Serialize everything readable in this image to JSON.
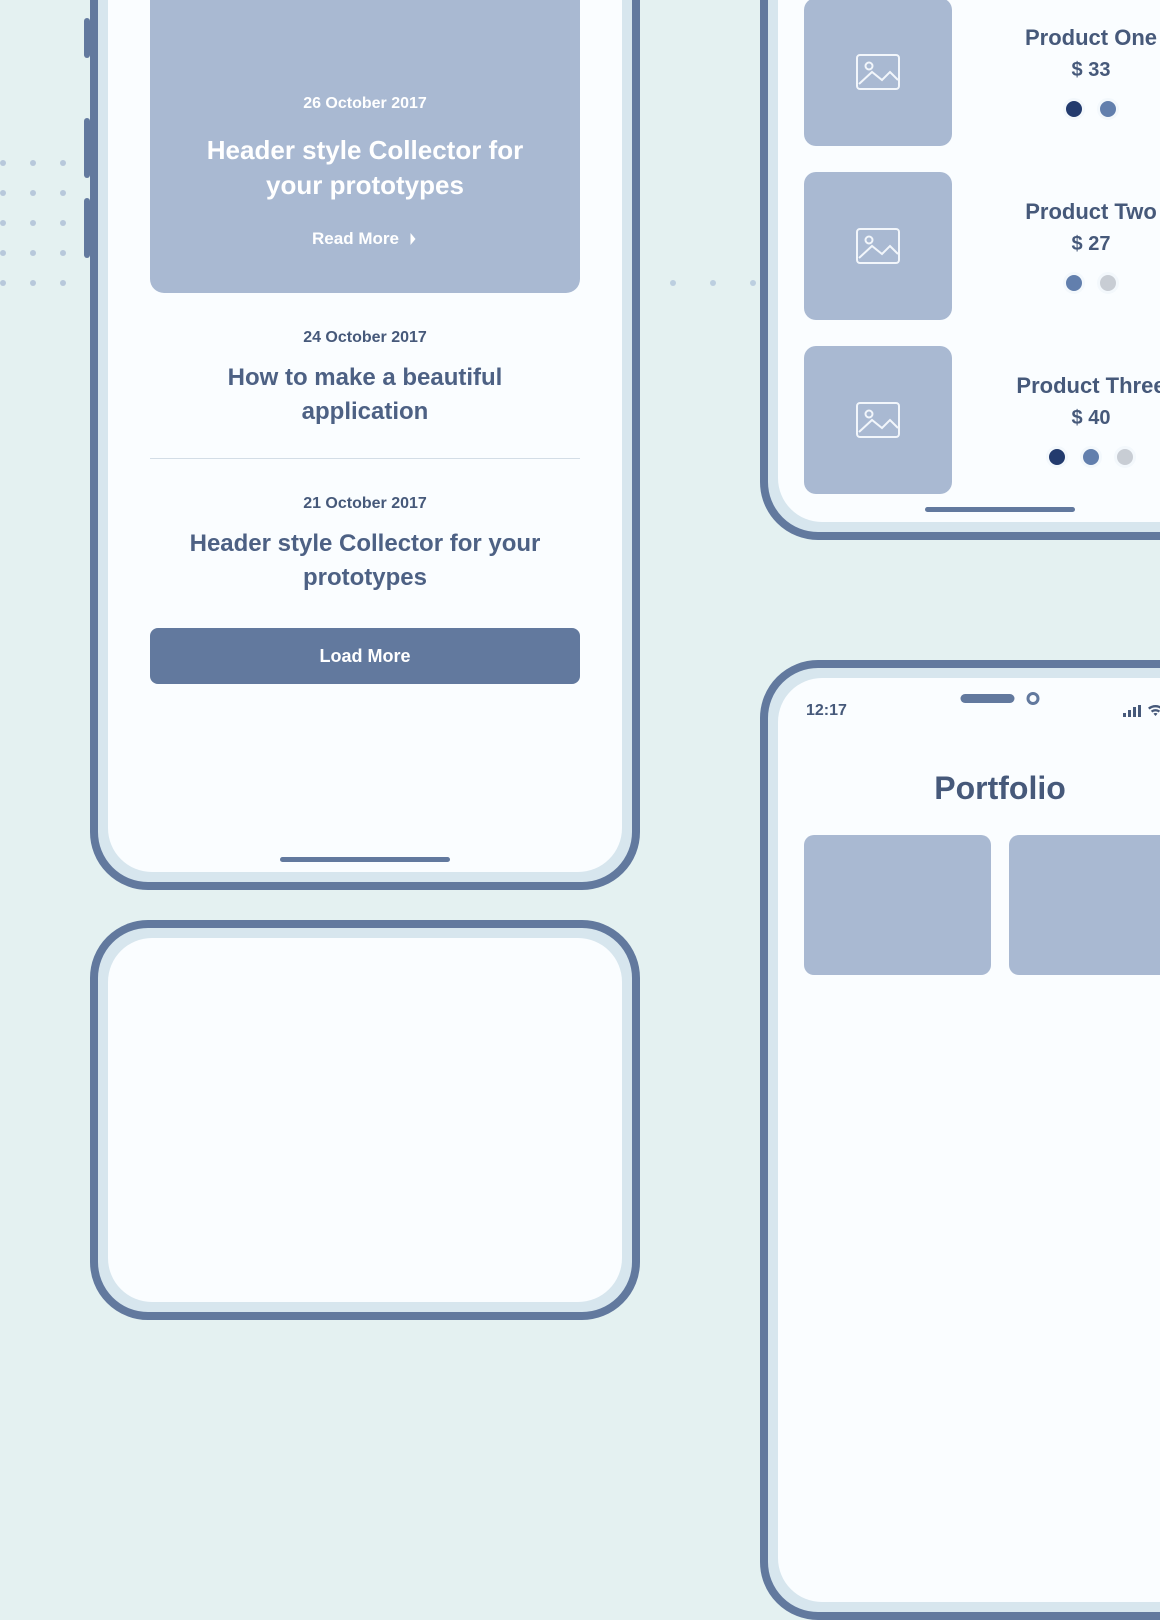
{
  "colors": {
    "dark": "#233b6e",
    "mid": "#627fad",
    "light": "#c8cdd4"
  },
  "blog": {
    "hero": {
      "date": "26 October 2017",
      "title": "Header style Collector for your prototypes",
      "read": "Read More"
    },
    "articles": [
      {
        "date": "24 October 2017",
        "title": "How to make a beautiful application"
      },
      {
        "date": "21 October 2017",
        "title": "Header style Collector for your prototypes"
      }
    ],
    "load": "Load More"
  },
  "products": [
    {
      "name": "Product One",
      "price": "$ 33",
      "swatches": [
        "dark",
        "mid"
      ]
    },
    {
      "name": "Product Two",
      "price": "$ 27",
      "swatches": [
        "mid",
        "light"
      ]
    },
    {
      "name": "Product Three",
      "price": "$ 40",
      "swatches": [
        "dark",
        "mid",
        "light"
      ]
    }
  ],
  "portfolio": {
    "time": "12:17",
    "title": "Portfolio"
  }
}
